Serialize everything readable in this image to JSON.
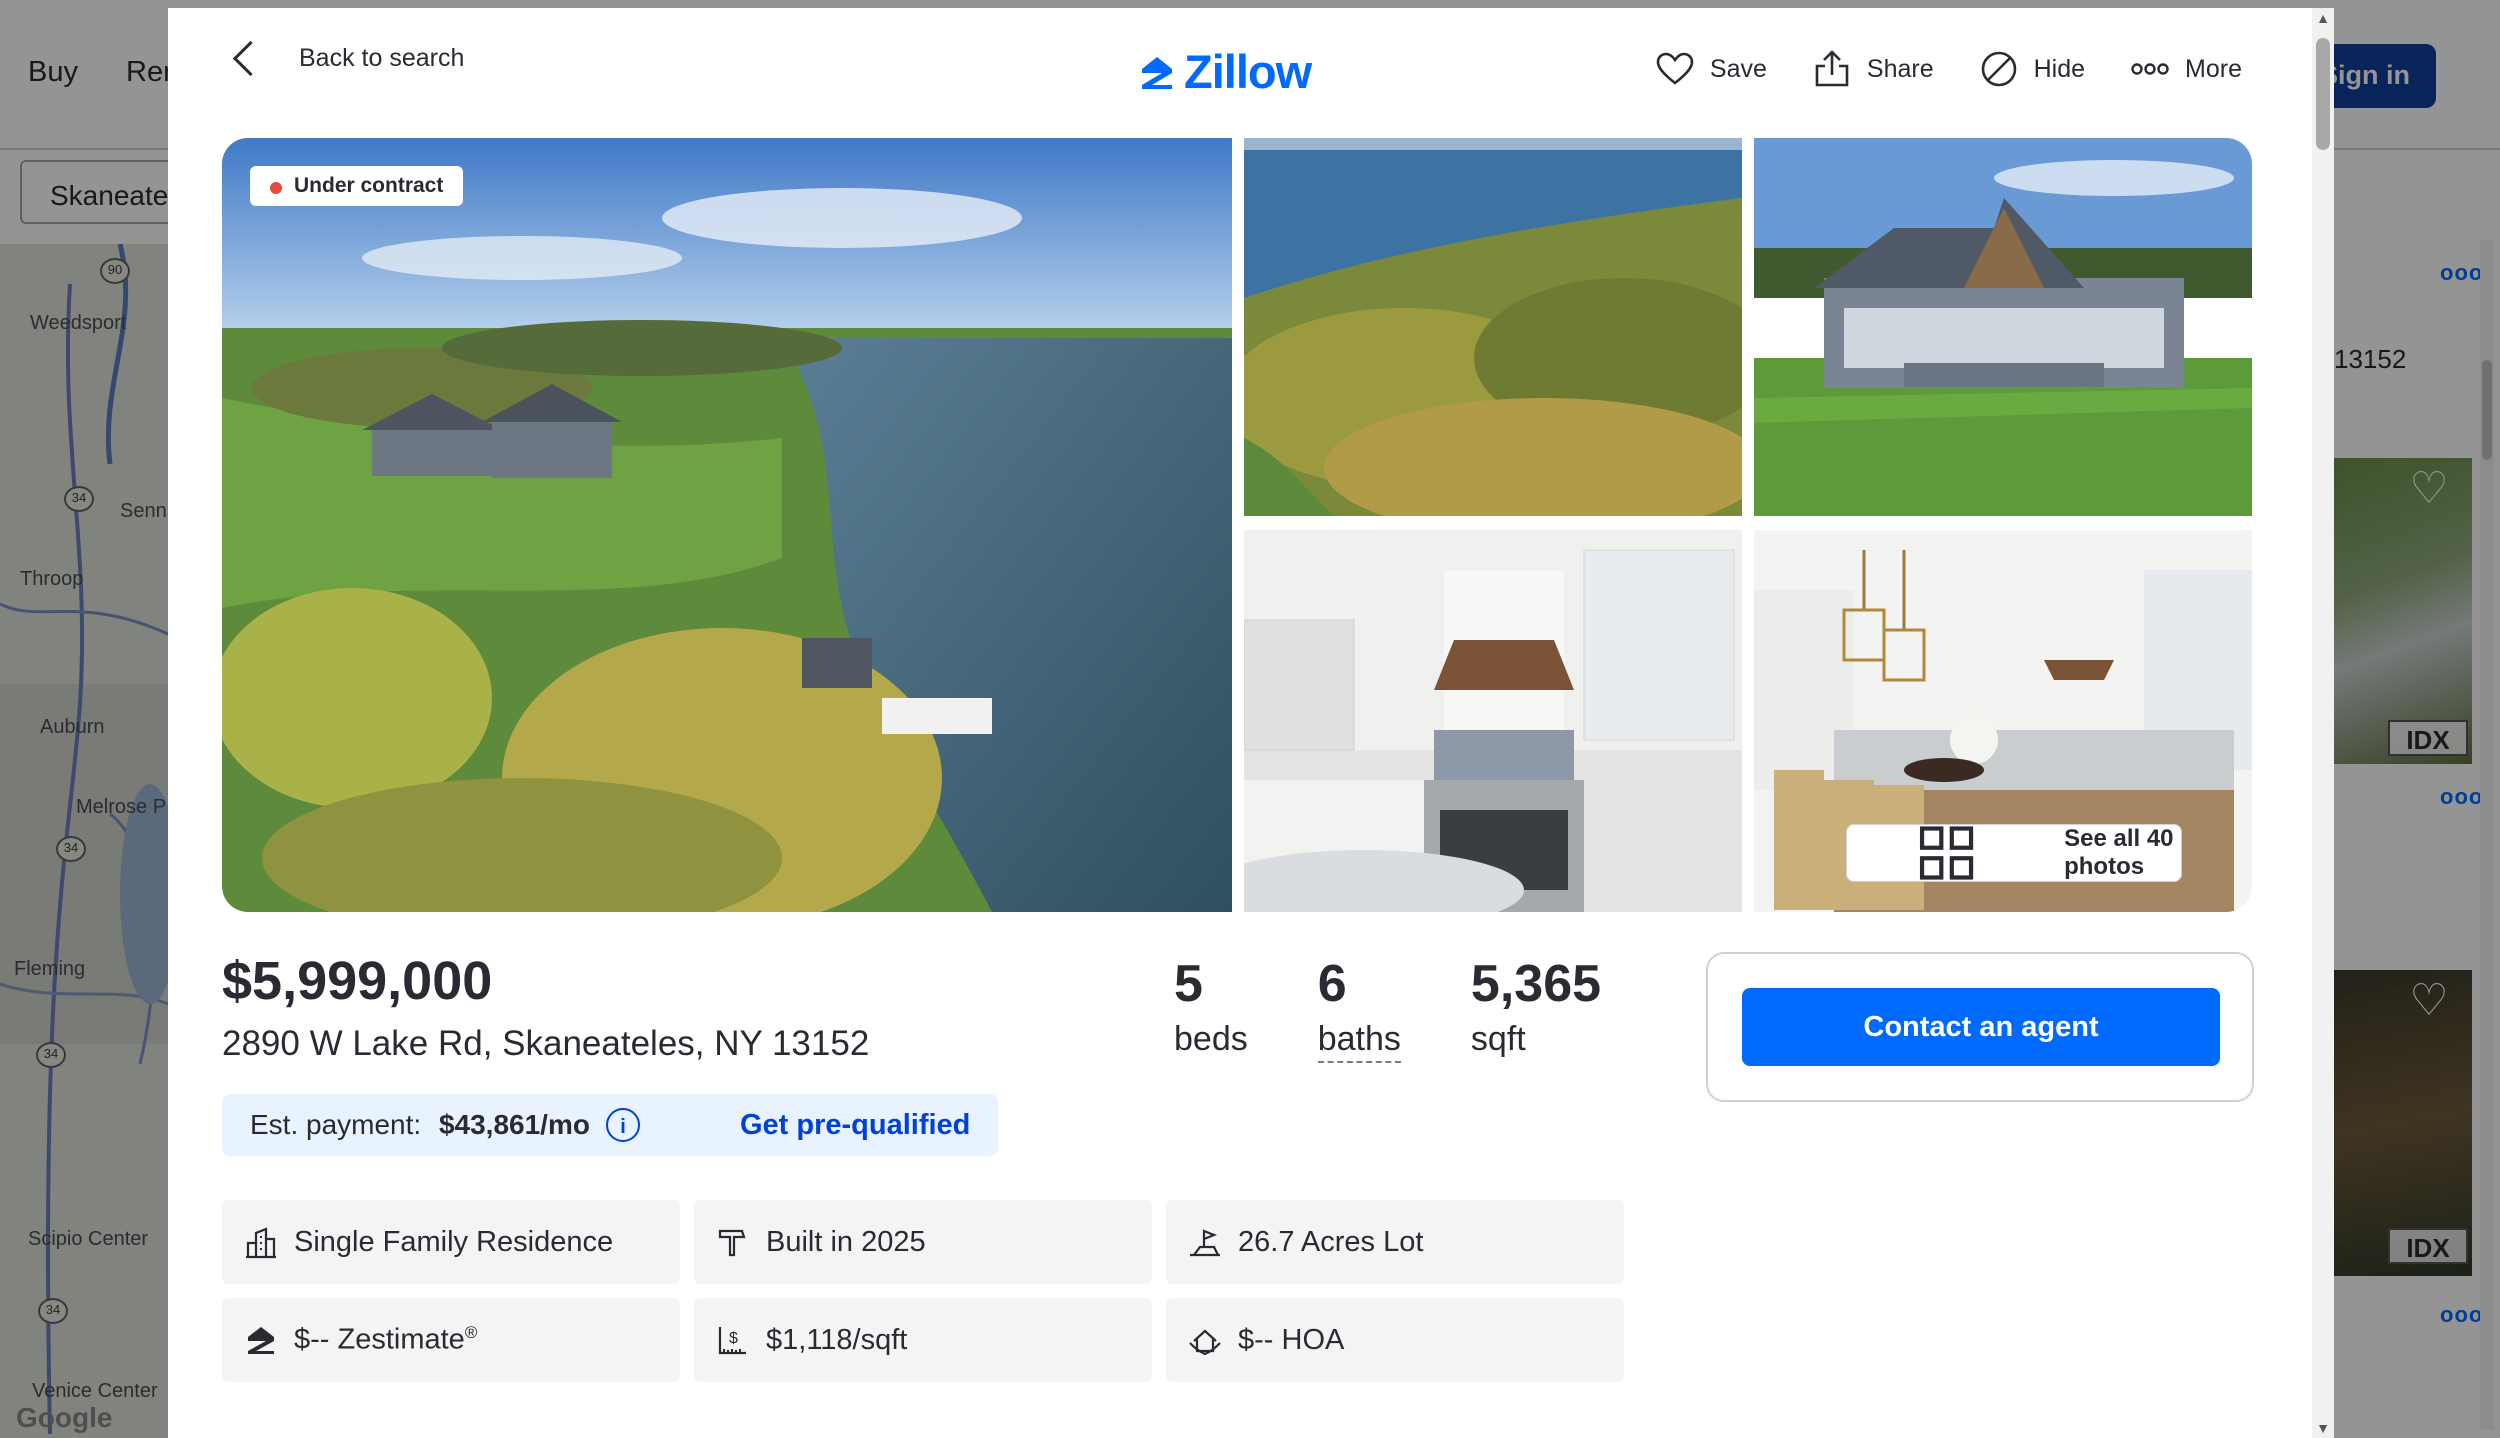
{
  "background": {
    "nav": [
      "Buy",
      "Ren"
    ],
    "search_value": "Skaneate",
    "sign_in": "Sign in",
    "map_labels": [
      "Weedsport",
      "Senn",
      "Throop",
      "Auburn",
      "Melrose P",
      "Fleming",
      "Scipio Center",
      "Venice Center",
      "Google"
    ],
    "map_shields": [
      "90",
      "34",
      "34",
      "34",
      "34"
    ],
    "list_zip": "13152",
    "idx_badge": "IDX",
    "more_dots": "ooo"
  },
  "header": {
    "back_label": "Back to search",
    "logo": "Zillow",
    "actions": [
      {
        "label": "Save",
        "icon": "heart-icon"
      },
      {
        "label": "Share",
        "icon": "share-icon"
      },
      {
        "label": "Hide",
        "icon": "hide-icon"
      },
      {
        "label": "More",
        "icon": "more-icon"
      }
    ]
  },
  "gallery": {
    "status": "Under contract",
    "status_color": "#e84a3b",
    "see_all": "See all 40 photos"
  },
  "summary": {
    "price": "$5,999,000",
    "address": "2890 W Lake Rd, Skaneateles, NY 13152",
    "beds": {
      "value": "5",
      "label": "beds"
    },
    "baths": {
      "value": "6",
      "label": "baths"
    },
    "sqft": {
      "value": "5,365",
      "label": "sqft"
    },
    "payment_prefix": "Est. payment: ",
    "payment_amount": "$43,861/mo",
    "prequal": "Get pre-qualified",
    "contact": "Contact an agent"
  },
  "features": [
    {
      "icon": "building-icon",
      "text": "Single Family Residence"
    },
    {
      "icon": "hammer-icon",
      "text": "Built in 2025"
    },
    {
      "icon": "lot-icon",
      "text": "26.7 Acres Lot"
    },
    {
      "icon": "zestimate-icon",
      "text": "$-- Zestimate",
      "sup": "®"
    },
    {
      "icon": "price-per-sqft-icon",
      "text": "$1,118/sqft"
    },
    {
      "icon": "hoa-icon",
      "text": "$-- HOA"
    }
  ],
  "colors": {
    "brand": "#006aff",
    "link": "#0041d9",
    "text": "#2a2a33"
  }
}
